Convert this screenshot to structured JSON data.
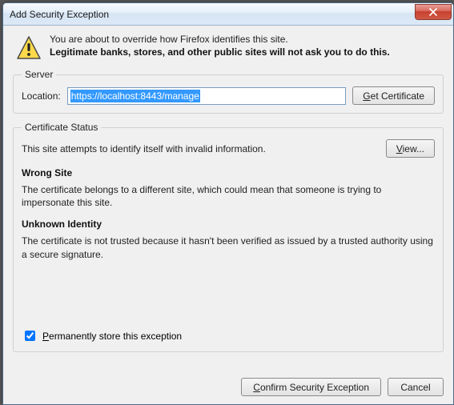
{
  "window": {
    "title": "Add Security Exception"
  },
  "intro": {
    "line1": "You are about to override how Firefox identifies this site.",
    "line2": "Legitimate banks, stores, and other public sites will not ask you to do this."
  },
  "server": {
    "legend": "Server",
    "location_label": "Location:",
    "location_value": "https://localhost:8443/manage",
    "get_cert_btn": "Get Certificate"
  },
  "status": {
    "legend": "Certificate Status",
    "summary": "This site attempts to identify itself with invalid information.",
    "view_btn": "View...",
    "h1": "Wrong Site",
    "p1": "The certificate belongs to a different site, which could mean that someone is trying to impersonate this site.",
    "h2": "Unknown Identity",
    "p2": "The certificate is not trusted because it hasn't been verified as issued by a trusted authority using a secure signature.",
    "perm_label": "Permanently store this exception"
  },
  "footer": {
    "confirm": "Confirm Security Exception",
    "cancel": "Cancel"
  }
}
